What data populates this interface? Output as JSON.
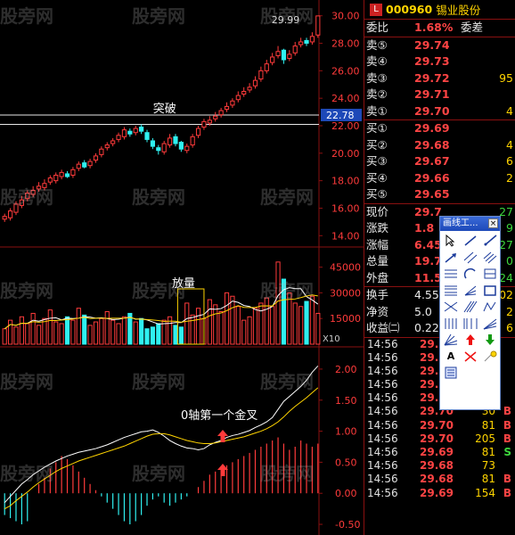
{
  "chart_data": [
    {
      "type": "candlestick",
      "title": "",
      "x": [
        "1",
        "2",
        "3",
        "4",
        "5",
        "6",
        "7",
        "8",
        "9",
        "10",
        "11",
        "12",
        "13",
        "14",
        "15",
        "16",
        "17",
        "18",
        "19",
        "20",
        "21",
        "22",
        "23",
        "24",
        "25",
        "26",
        "27",
        "28",
        "29",
        "30",
        "31",
        "32",
        "33",
        "34",
        "35",
        "36",
        "37",
        "38",
        "39",
        "40",
        "41",
        "42",
        "43",
        "44",
        "45",
        "46",
        "47",
        "48",
        "49",
        "50",
        "51",
        "52",
        "53",
        "54",
        "55",
        "56"
      ],
      "open": [
        15.2,
        15.3,
        15.7,
        16.2,
        16.7,
        17.0,
        17.4,
        17.5,
        17.9,
        18.0,
        18.3,
        18.5,
        18.4,
        18.9,
        19.3,
        19.1,
        19.5,
        19.9,
        20.4,
        20.7,
        21.0,
        21.2,
        21.6,
        21.5,
        21.9,
        21.5,
        20.9,
        20.4,
        20.1,
        20.6,
        21.2,
        20.8,
        20.2,
        20.6,
        21.3,
        21.9,
        22.2,
        22.5,
        22.8,
        23.2,
        23.5,
        23.9,
        24.3,
        24.6,
        24.9,
        25.4,
        26.0,
        26.6,
        27.1,
        27.5,
        26.9,
        27.3,
        27.9,
        28.2,
        28.1,
        28.6
      ],
      "close": [
        15.4,
        15.8,
        16.3,
        16.6,
        17.1,
        17.3,
        17.6,
        17.8,
        18.2,
        18.4,
        18.6,
        18.3,
        18.8,
        19.2,
        19.0,
        19.4,
        19.8,
        20.3,
        20.6,
        20.9,
        21.3,
        21.7,
        21.4,
        21.8,
        21.6,
        21.0,
        20.5,
        20.2,
        20.7,
        21.1,
        20.7,
        20.3,
        20.5,
        21.2,
        21.8,
        22.3,
        22.4,
        22.7,
        23.1,
        23.4,
        23.8,
        24.2,
        24.5,
        24.8,
        25.3,
        26.0,
        26.5,
        27.0,
        27.4,
        26.8,
        27.2,
        27.8,
        28.1,
        28.0,
        28.5,
        29.99
      ],
      "high": [
        15.6,
        16.0,
        16.5,
        16.9,
        17.3,
        17.6,
        17.9,
        18.1,
        18.4,
        18.6,
        18.8,
        18.7,
        19.0,
        19.4,
        19.5,
        19.6,
        20.0,
        20.5,
        20.8,
        21.1,
        21.5,
        21.9,
        21.8,
        22.0,
        22.1,
        21.7,
        21.1,
        20.6,
        20.9,
        21.4,
        21.4,
        20.9,
        20.7,
        21.4,
        22.0,
        22.5,
        22.7,
        23.0,
        23.3,
        23.7,
        24.0,
        24.5,
        24.8,
        25.1,
        25.6,
        26.3,
        26.8,
        27.3,
        27.8,
        27.6,
        27.5,
        28.1,
        28.4,
        28.4,
        28.8,
        29.99
      ],
      "low": [
        15.0,
        15.1,
        15.5,
        16.0,
        16.5,
        16.8,
        17.2,
        17.3,
        17.7,
        17.8,
        18.1,
        18.2,
        18.2,
        18.7,
        18.9,
        18.9,
        19.3,
        19.7,
        20.2,
        20.5,
        20.8,
        21.0,
        21.2,
        21.3,
        21.4,
        20.8,
        20.3,
        19.9,
        19.9,
        20.4,
        20.5,
        20.1,
        20.0,
        20.4,
        21.1,
        21.7,
        22.0,
        22.3,
        22.6,
        23.0,
        23.3,
        23.7,
        24.1,
        24.4,
        24.7,
        25.2,
        25.8,
        26.4,
        26.9,
        26.5,
        26.7,
        27.1,
        27.7,
        27.8,
        27.9,
        28.4
      ],
      "ylim": [
        13.5,
        30.5
      ],
      "yticks": [
        "30.00",
        "28.00",
        "26.00",
        "24.00",
        "22.00",
        "20.00",
        "18.00",
        "16.00",
        "14.00"
      ],
      "current_price_label": "22.78",
      "high_label": "29.99",
      "annotation": "突破",
      "grid": false
    },
    {
      "type": "bar",
      "values": [
        9000,
        14000,
        10000,
        16000,
        12000,
        18000,
        11000,
        15000,
        20000,
        13000,
        12000,
        16000,
        14000,
        21000,
        17000,
        11000,
        13000,
        15000,
        19000,
        14000,
        12000,
        16000,
        18000,
        13000,
        15000,
        9000,
        10000,
        12000,
        14000,
        16000,
        11000,
        10000,
        24000,
        17000,
        21000,
        15000,
        26000,
        23000,
        19000,
        30000,
        28000,
        22000,
        14000,
        16000,
        21000,
        24000,
        27000,
        22000,
        48000,
        38000,
        30000,
        24000,
        22000,
        25000,
        28000,
        18000
      ],
      "ylim": [
        0,
        50000
      ],
      "yticks": [
        "45000",
        "30000",
        "15000"
      ],
      "unit_label": "X10",
      "annotation": "放量"
    },
    {
      "type": "line",
      "series": [
        {
          "values": [
            -0.15,
            -0.05,
            0.05,
            0.15,
            0.22,
            0.3,
            0.36,
            0.42,
            0.47,
            0.52,
            0.56,
            0.6,
            0.63,
            0.66,
            0.68,
            0.7,
            0.72,
            0.75,
            0.78,
            0.82,
            0.86,
            0.9,
            0.93,
            0.96,
            0.99,
            1.0,
            1.02,
            0.98,
            0.92,
            0.85,
            0.8,
            0.76,
            0.73,
            0.72,
            0.7,
            0.72,
            0.78,
            0.82,
            0.85,
            0.9,
            0.93,
            0.95,
            0.98,
            1.01,
            1.06,
            1.1,
            1.15,
            1.22,
            1.35,
            1.48,
            1.56,
            1.64,
            1.72,
            1.82,
            1.95,
            2.05
          ]
        },
        {
          "values": [
            -0.25,
            -0.2,
            -0.12,
            -0.05,
            0.02,
            0.1,
            0.17,
            0.23,
            0.29,
            0.35,
            0.4,
            0.44,
            0.48,
            0.52,
            0.55,
            0.58,
            0.61,
            0.64,
            0.67,
            0.7,
            0.73,
            0.76,
            0.8,
            0.84,
            0.88,
            0.92,
            0.95,
            0.96,
            0.96,
            0.94,
            0.91,
            0.88,
            0.85,
            0.83,
            0.81,
            0.8,
            0.8,
            0.81,
            0.83,
            0.85,
            0.87,
            0.89,
            0.91,
            0.94,
            0.97,
            1.0,
            1.04,
            1.09,
            1.15,
            1.23,
            1.32,
            1.4,
            1.47,
            1.54,
            1.62,
            1.7
          ]
        }
      ],
      "bars": [
        -0.35,
        -0.4,
        -0.45,
        -0.5,
        -0.45,
        0.0,
        0.15,
        0.25,
        0.4,
        0.5,
        0.6,
        0.55,
        0.45,
        0.35,
        0.25,
        0.15,
        0.05,
        -0.05,
        -0.15,
        -0.25,
        -0.35,
        -0.45,
        -0.5,
        -0.45,
        -0.35,
        -0.2,
        -0.1,
        -0.05,
        -0.15,
        -0.2,
        -0.15,
        -0.1,
        -0.05,
        0.0,
        0.1,
        0.2,
        0.3,
        0.35,
        0.4,
        0.45,
        0.5,
        0.55,
        0.6,
        0.65,
        0.7,
        0.75,
        0.8,
        0.85,
        0.9,
        0.8,
        0.7,
        0.75,
        0.85,
        0.8,
        0.75,
        0.8
      ],
      "ylim": [
        -0.6,
        2.2
      ],
      "yticks": [
        "2.00",
        "1.50",
        "1.00",
        "0.50",
        "0.00",
        "-0.50"
      ],
      "annotation": "0轴第一个金叉"
    }
  ],
  "header": {
    "badge": "L",
    "code": "000960",
    "name": "锡业股份"
  },
  "quote": {
    "ratio": {
      "label": "委比",
      "value": "1.68%",
      "ext_label": "委差"
    },
    "sell": [
      {
        "label": "卖⑤",
        "price": "29.74",
        "vol": ""
      },
      {
        "label": "卖④",
        "price": "29.73",
        "vol": ""
      },
      {
        "label": "卖③",
        "price": "29.72",
        "vol": "95"
      },
      {
        "label": "卖②",
        "price": "29.71",
        "vol": ""
      },
      {
        "label": "卖①",
        "price": "29.70",
        "vol": "4"
      }
    ],
    "buy": [
      {
        "label": "买①",
        "price": "29.69",
        "vol": ""
      },
      {
        "label": "买②",
        "price": "29.68",
        "vol": "4"
      },
      {
        "label": "买③",
        "price": "29.67",
        "vol": "6"
      },
      {
        "label": "买④",
        "price": "29.66",
        "vol": "2"
      },
      {
        "label": "买⑤",
        "price": "29.65",
        "vol": ""
      }
    ],
    "stats": [
      {
        "label": "现价",
        "value": "29.7",
        "ext": "27"
      },
      {
        "label": "涨跌",
        "value": "1.8",
        "ext": "9"
      },
      {
        "label": "涨幅",
        "value": "6.45",
        "ext": "27"
      },
      {
        "label": "总量",
        "value": "19.7",
        "ext": "0"
      },
      {
        "label": "外盘",
        "value": "11.5",
        "ext": "24"
      }
    ],
    "extra": [
      {
        "label": "换手",
        "value": "4.55",
        "ext": "02"
      },
      {
        "label": "净资",
        "value": "5.0",
        "ext": "2"
      },
      {
        "label": "收益㈡",
        "value": "0.22",
        "ext": "6"
      }
    ]
  },
  "ticks": [
    {
      "time": "14:56",
      "price": "29.69",
      "vol": "",
      "dir": ""
    },
    {
      "time": "14:56",
      "price": "29.69",
      "vol": "",
      "dir": ""
    },
    {
      "time": "14:56",
      "price": "29.69",
      "vol": "",
      "dir": ""
    },
    {
      "time": "14:56",
      "price": "29.69",
      "vol": "",
      "dir": ""
    },
    {
      "time": "14:56",
      "price": "29.70",
      "vol": "",
      "dir": ""
    },
    {
      "time": "14:56",
      "price": "29.70",
      "vol": "30",
      "dir": "B"
    },
    {
      "time": "14:56",
      "price": "29.70",
      "vol": "81",
      "dir": "B"
    },
    {
      "time": "14:56",
      "price": "29.70",
      "vol": "205",
      "dir": "B"
    },
    {
      "time": "14:56",
      "price": "29.69",
      "vol": "81",
      "dir": "S"
    },
    {
      "time": "14:56",
      "price": "29.68",
      "vol": "73",
      "dir": ""
    },
    {
      "time": "14:56",
      "price": "29.68",
      "vol": "81",
      "dir": "B"
    },
    {
      "time": "14:56",
      "price": "29.69",
      "vol": "154",
      "dir": "B"
    }
  ],
  "toolbox": {
    "title": "画线工...",
    "close": "×",
    "text_tool": "A"
  },
  "watermark": "股旁网",
  "colors": {
    "up": "#ff3b3b",
    "down": "#2ff0f0",
    "text_yellow": "#ffd400",
    "frame": "#8a1010"
  }
}
